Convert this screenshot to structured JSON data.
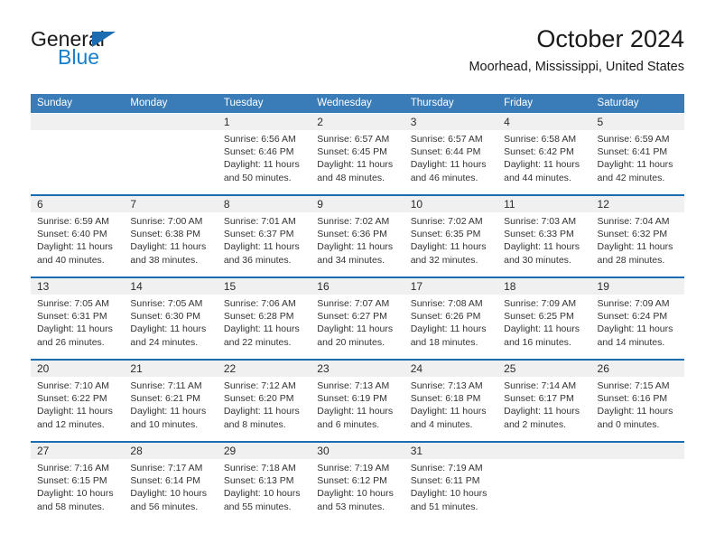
{
  "brand": {
    "name_part1": "General",
    "name_part2": "Blue",
    "triangle_color": "#1b6cb0",
    "blue_color": "#1b7ec9"
  },
  "header": {
    "title": "October 2024",
    "location": "Moorhead, Mississippi, United States"
  },
  "theme": {
    "header_blue": "#3a7cb8",
    "divider_blue": "#1b6cb0",
    "band_gray": "#f0f0f0"
  },
  "calendar": {
    "weekdays": [
      "Sunday",
      "Monday",
      "Tuesday",
      "Wednesday",
      "Thursday",
      "Friday",
      "Saturday"
    ],
    "weeks": [
      [
        {
          "day": "",
          "lines": []
        },
        {
          "day": "",
          "lines": []
        },
        {
          "day": "1",
          "lines": [
            "Sunrise: 6:56 AM",
            "Sunset: 6:46 PM",
            "Daylight: 11 hours",
            "and 50 minutes."
          ]
        },
        {
          "day": "2",
          "lines": [
            "Sunrise: 6:57 AM",
            "Sunset: 6:45 PM",
            "Daylight: 11 hours",
            "and 48 minutes."
          ]
        },
        {
          "day": "3",
          "lines": [
            "Sunrise: 6:57 AM",
            "Sunset: 6:44 PM",
            "Daylight: 11 hours",
            "and 46 minutes."
          ]
        },
        {
          "day": "4",
          "lines": [
            "Sunrise: 6:58 AM",
            "Sunset: 6:42 PM",
            "Daylight: 11 hours",
            "and 44 minutes."
          ]
        },
        {
          "day": "5",
          "lines": [
            "Sunrise: 6:59 AM",
            "Sunset: 6:41 PM",
            "Daylight: 11 hours",
            "and 42 minutes."
          ]
        }
      ],
      [
        {
          "day": "6",
          "lines": [
            "Sunrise: 6:59 AM",
            "Sunset: 6:40 PM",
            "Daylight: 11 hours",
            "and 40 minutes."
          ]
        },
        {
          "day": "7",
          "lines": [
            "Sunrise: 7:00 AM",
            "Sunset: 6:38 PM",
            "Daylight: 11 hours",
            "and 38 minutes."
          ]
        },
        {
          "day": "8",
          "lines": [
            "Sunrise: 7:01 AM",
            "Sunset: 6:37 PM",
            "Daylight: 11 hours",
            "and 36 minutes."
          ]
        },
        {
          "day": "9",
          "lines": [
            "Sunrise: 7:02 AM",
            "Sunset: 6:36 PM",
            "Daylight: 11 hours",
            "and 34 minutes."
          ]
        },
        {
          "day": "10",
          "lines": [
            "Sunrise: 7:02 AM",
            "Sunset: 6:35 PM",
            "Daylight: 11 hours",
            "and 32 minutes."
          ]
        },
        {
          "day": "11",
          "lines": [
            "Sunrise: 7:03 AM",
            "Sunset: 6:33 PM",
            "Daylight: 11 hours",
            "and 30 minutes."
          ]
        },
        {
          "day": "12",
          "lines": [
            "Sunrise: 7:04 AM",
            "Sunset: 6:32 PM",
            "Daylight: 11 hours",
            "and 28 minutes."
          ]
        }
      ],
      [
        {
          "day": "13",
          "lines": [
            "Sunrise: 7:05 AM",
            "Sunset: 6:31 PM",
            "Daylight: 11 hours",
            "and 26 minutes."
          ]
        },
        {
          "day": "14",
          "lines": [
            "Sunrise: 7:05 AM",
            "Sunset: 6:30 PM",
            "Daylight: 11 hours",
            "and 24 minutes."
          ]
        },
        {
          "day": "15",
          "lines": [
            "Sunrise: 7:06 AM",
            "Sunset: 6:28 PM",
            "Daylight: 11 hours",
            "and 22 minutes."
          ]
        },
        {
          "day": "16",
          "lines": [
            "Sunrise: 7:07 AM",
            "Sunset: 6:27 PM",
            "Daylight: 11 hours",
            "and 20 minutes."
          ]
        },
        {
          "day": "17",
          "lines": [
            "Sunrise: 7:08 AM",
            "Sunset: 6:26 PM",
            "Daylight: 11 hours",
            "and 18 minutes."
          ]
        },
        {
          "day": "18",
          "lines": [
            "Sunrise: 7:09 AM",
            "Sunset: 6:25 PM",
            "Daylight: 11 hours",
            "and 16 minutes."
          ]
        },
        {
          "day": "19",
          "lines": [
            "Sunrise: 7:09 AM",
            "Sunset: 6:24 PM",
            "Daylight: 11 hours",
            "and 14 minutes."
          ]
        }
      ],
      [
        {
          "day": "20",
          "lines": [
            "Sunrise: 7:10 AM",
            "Sunset: 6:22 PM",
            "Daylight: 11 hours",
            "and 12 minutes."
          ]
        },
        {
          "day": "21",
          "lines": [
            "Sunrise: 7:11 AM",
            "Sunset: 6:21 PM",
            "Daylight: 11 hours",
            "and 10 minutes."
          ]
        },
        {
          "day": "22",
          "lines": [
            "Sunrise: 7:12 AM",
            "Sunset: 6:20 PM",
            "Daylight: 11 hours",
            "and 8 minutes."
          ]
        },
        {
          "day": "23",
          "lines": [
            "Sunrise: 7:13 AM",
            "Sunset: 6:19 PM",
            "Daylight: 11 hours",
            "and 6 minutes."
          ]
        },
        {
          "day": "24",
          "lines": [
            "Sunrise: 7:13 AM",
            "Sunset: 6:18 PM",
            "Daylight: 11 hours",
            "and 4 minutes."
          ]
        },
        {
          "day": "25",
          "lines": [
            "Sunrise: 7:14 AM",
            "Sunset: 6:17 PM",
            "Daylight: 11 hours",
            "and 2 minutes."
          ]
        },
        {
          "day": "26",
          "lines": [
            "Sunrise: 7:15 AM",
            "Sunset: 6:16 PM",
            "Daylight: 11 hours",
            "and 0 minutes."
          ]
        }
      ],
      [
        {
          "day": "27",
          "lines": [
            "Sunrise: 7:16 AM",
            "Sunset: 6:15 PM",
            "Daylight: 10 hours",
            "and 58 minutes."
          ]
        },
        {
          "day": "28",
          "lines": [
            "Sunrise: 7:17 AM",
            "Sunset: 6:14 PM",
            "Daylight: 10 hours",
            "and 56 minutes."
          ]
        },
        {
          "day": "29",
          "lines": [
            "Sunrise: 7:18 AM",
            "Sunset: 6:13 PM",
            "Daylight: 10 hours",
            "and 55 minutes."
          ]
        },
        {
          "day": "30",
          "lines": [
            "Sunrise: 7:19 AM",
            "Sunset: 6:12 PM",
            "Daylight: 10 hours",
            "and 53 minutes."
          ]
        },
        {
          "day": "31",
          "lines": [
            "Sunrise: 7:19 AM",
            "Sunset: 6:11 PM",
            "Daylight: 10 hours",
            "and 51 minutes."
          ]
        },
        {
          "day": "",
          "lines": []
        },
        {
          "day": "",
          "lines": []
        }
      ]
    ]
  }
}
